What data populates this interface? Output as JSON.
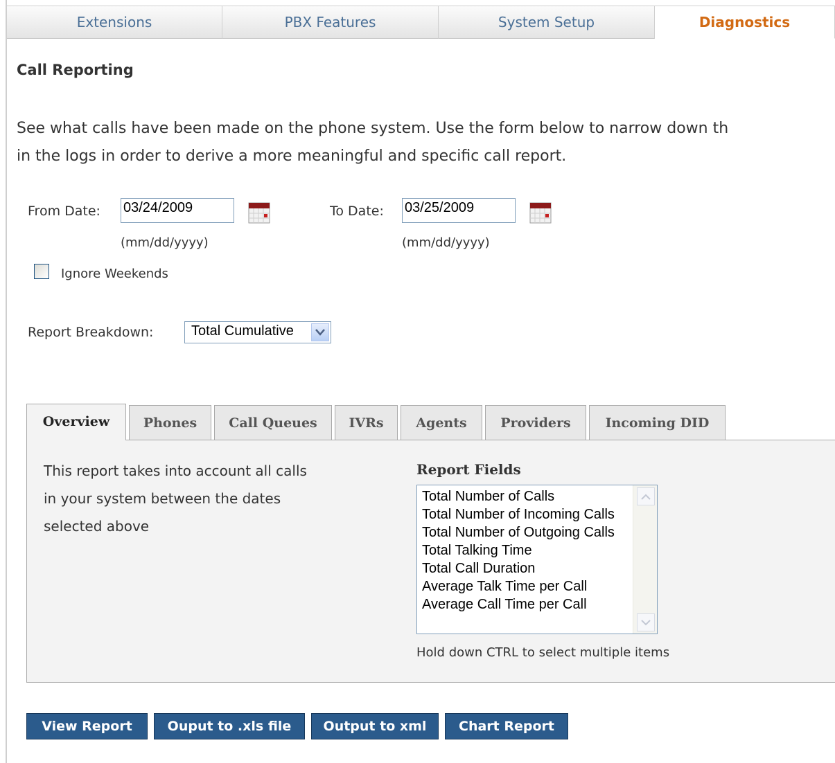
{
  "nav": {
    "tabs": [
      {
        "label": "Extensions"
      },
      {
        "label": "PBX Features"
      },
      {
        "label": "System Setup"
      },
      {
        "label": "Diagnostics"
      }
    ]
  },
  "page": {
    "title": "Call Reporting",
    "intro_line1": "See what calls have been made on the phone system. Use the form below to narrow down th",
    "intro_line2": "in the logs in order to derive a more meaningful and specific call report."
  },
  "form": {
    "from_label": "From Date:",
    "from_value": "03/24/2009",
    "to_label": "To Date:",
    "to_value": "03/25/2009",
    "date_hint": "(mm/dd/yyyy)",
    "ignore_weekends_label": "Ignore Weekends",
    "breakdown_label": "Report Breakdown:",
    "breakdown_value": "Total Cumulative"
  },
  "report_tabs": [
    {
      "label": "Overview"
    },
    {
      "label": "Phones"
    },
    {
      "label": "Call Queues"
    },
    {
      "label": "IVRs"
    },
    {
      "label": "Agents"
    },
    {
      "label": "Providers"
    },
    {
      "label": "Incoming DID"
    }
  ],
  "overview": {
    "description_line1": "This report takes into account all calls",
    "description_line2": "in your system between the dates",
    "description_line3": "selected above",
    "fields_heading": "Report Fields",
    "fields": [
      "Total Number of Calls",
      "Total Number of Incoming Calls",
      "Total Number of Outgoing Calls",
      "Total Talking Time",
      "Total Call Duration",
      "Average Talk Time per Call",
      "Average Call Time per Call"
    ],
    "ctrl_hint": "Hold down CTRL to select multiple items"
  },
  "buttons": {
    "view_report": "View Report",
    "output_xls": "Ouput to .xls file",
    "output_xml": "Output to xml",
    "chart_report": "Chart Report"
  }
}
